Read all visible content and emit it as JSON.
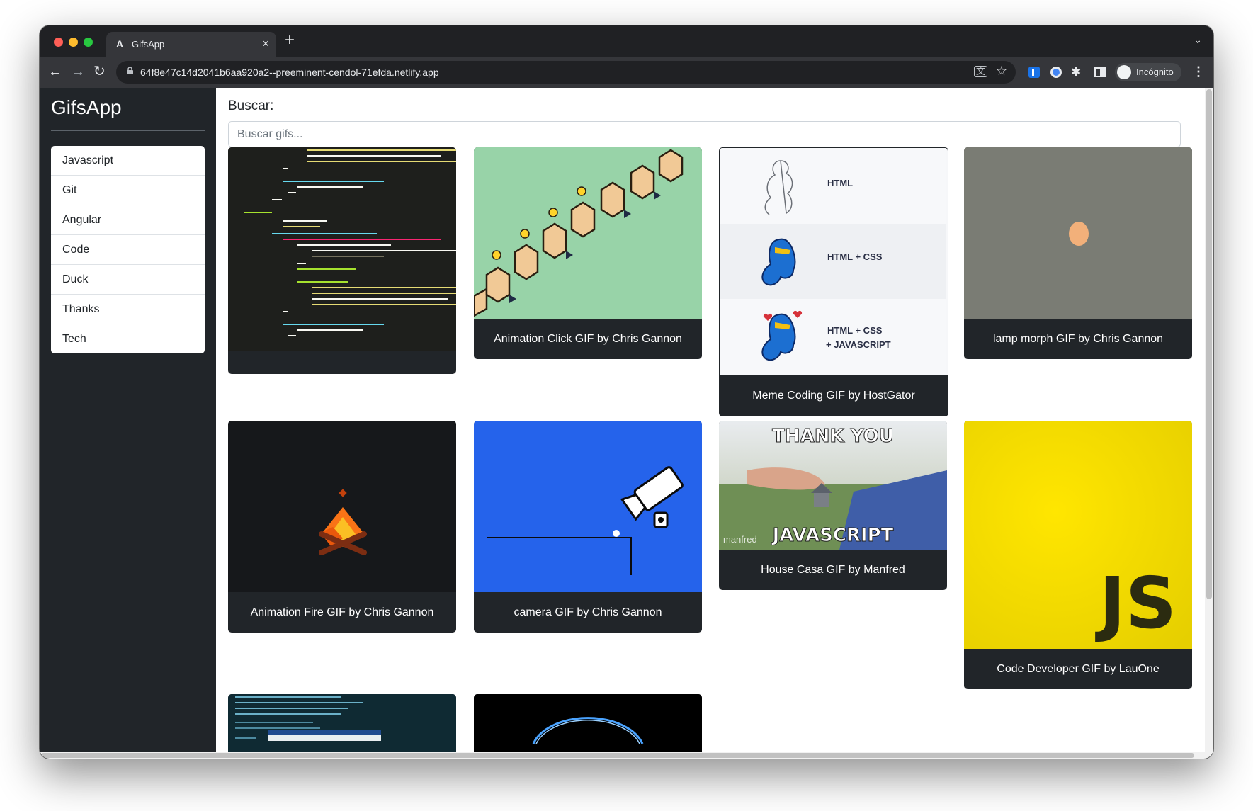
{
  "browser": {
    "tab_title": "GifsApp",
    "tab_favicon": "A",
    "url": "64f8e47c14d2041b6aa920a2--preeminent-cendol-71efda.netlify.app",
    "profile_label": "Incógnito",
    "icons": [
      "close-icon",
      "new-tab-icon",
      "back-icon",
      "forward-icon",
      "reload-icon",
      "lock-icon",
      "translate-icon",
      "star-icon",
      "extension-icon",
      "sidepanel-icon",
      "incognito-icon",
      "menu-icon"
    ]
  },
  "sidebar": {
    "title": "GifsApp",
    "items": [
      {
        "label": "Javascript"
      },
      {
        "label": "Git"
      },
      {
        "label": "Angular"
      },
      {
        "label": "Code"
      },
      {
        "label": "Duck"
      },
      {
        "label": "Thanks"
      },
      {
        "label": "Tech"
      }
    ]
  },
  "search": {
    "label": "Buscar:",
    "placeholder": "Buscar gifs..."
  },
  "gifs": [
    {
      "title": ""
    },
    {
      "title": "Animation Click GIF by Chris Gannon"
    },
    {
      "title": "Meme Coding GIF by HostGator"
    },
    {
      "title": "lamp morph GIF by Chris Gannon"
    },
    {
      "title": "Animation Fire GIF by Chris Gannon"
    },
    {
      "title": "camera GIF by Chris Gannon"
    },
    {
      "title": "House Casa GIF by Manfred"
    },
    {
      "title": "Code Developer GIF by LauOne"
    },
    {
      "title": ""
    },
    {
      "title": ""
    }
  ],
  "gif_images": {
    "meme": {
      "l1": "HTML",
      "l2": "HTML + CSS",
      "l3a": "HTML + CSS",
      "l3b": "+ JAVASCRIPT"
    },
    "house": {
      "top": "THANK YOU",
      "bottom": "JAVASCRIPT",
      "watermark": "manfred"
    },
    "js_logo": "JS"
  },
  "colors": {
    "sidebar_bg": "#212529",
    "card_bg": "#212529",
    "click_bg": "#98d3a8",
    "lamp_bg": "#7a7c74",
    "camera_bg": "#2563eb",
    "js_bg": "#f7df1e",
    "fire": "#f97316"
  }
}
